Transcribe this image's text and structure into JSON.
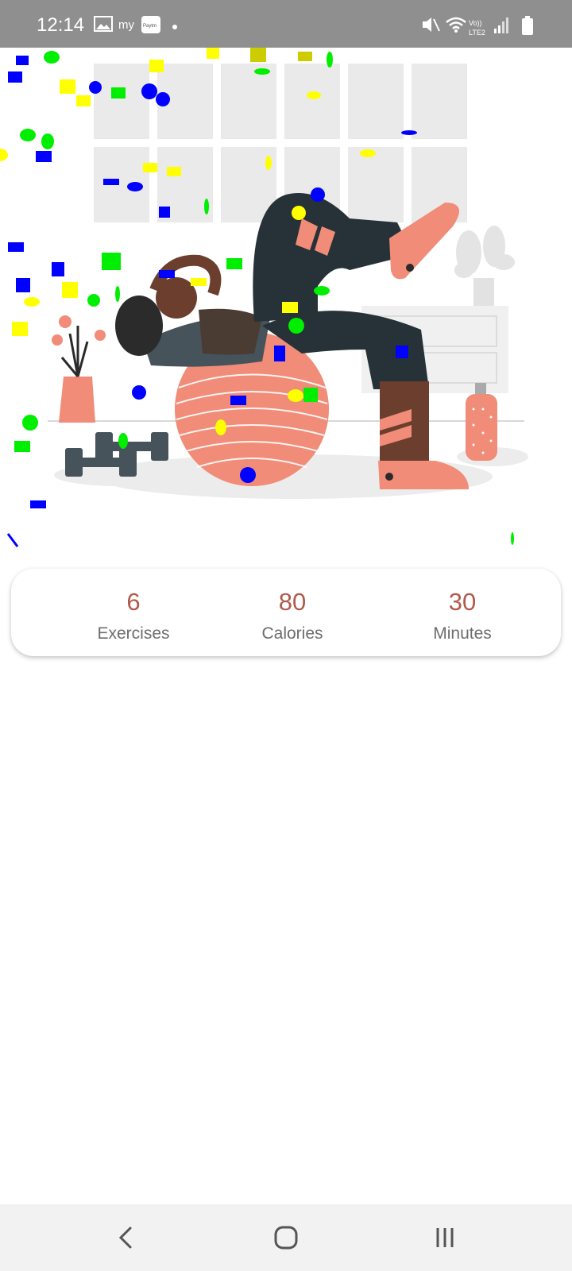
{
  "status_bar": {
    "time": "12:14",
    "left_icons": [
      "gallery-icon",
      "myjio-icon",
      "paytm-icon",
      "notification-dot-icon"
    ],
    "right_icons": [
      "mute-icon",
      "wifi-icon",
      "volte-icon",
      "signal-icon",
      "battery-icon"
    ],
    "network_label": "Vo)) LTE2",
    "paytm_label": "Paytm",
    "my_label": "my"
  },
  "illustration": {
    "description_icon": "woman-exercise-ball-icon"
  },
  "stats": [
    {
      "value": "6",
      "label": "Exercises"
    },
    {
      "value": "80",
      "label": "Calories"
    },
    {
      "value": "30",
      "label": "Minutes"
    }
  ],
  "colors": {
    "stat_value": "#b05a4c",
    "stat_label": "#6d6d6d",
    "status_bar": "#8f8f8f",
    "confetti": [
      "#0000ff",
      "#00ee00",
      "#ffff00"
    ]
  },
  "nav_bar": {
    "buttons": [
      "back-icon",
      "home-icon",
      "recents-icon"
    ]
  }
}
